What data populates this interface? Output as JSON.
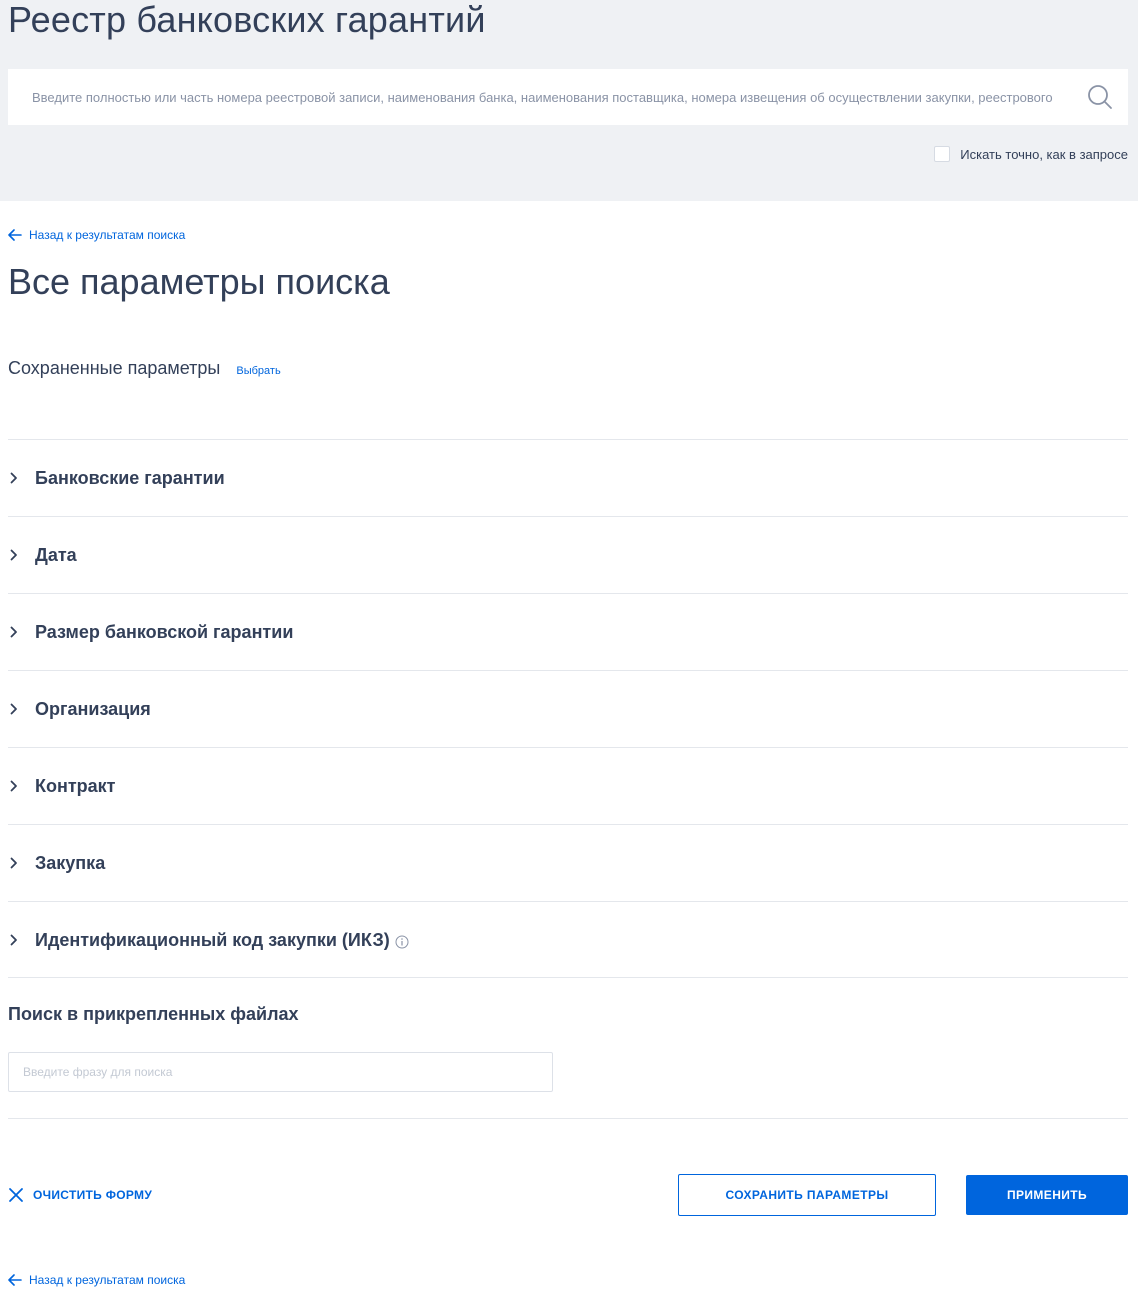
{
  "header": {
    "title": "Реестр банковских гарантий",
    "search_placeholder": "Введите полностью или часть номера реестровой записи, наименования банка, наименования поставщика, номера извещения об осуществлении закупки, реестрового",
    "search_icon": "search-icon",
    "exact_label": "Искать точно, как в запросе",
    "exact_checked": false
  },
  "nav": {
    "back_label": "Назад к результатам поиска",
    "back_icon": "arrow-left-icon"
  },
  "page": {
    "title": "Все параметры поиска",
    "saved_label": "Сохраненные параметры",
    "saved_choose": "Выбрать"
  },
  "accordion": [
    {
      "label": "Банковские гарантии"
    },
    {
      "label": "Дата"
    },
    {
      "label": "Размер банковской гарантии"
    },
    {
      "label": "Организация"
    },
    {
      "label": "Контракт"
    },
    {
      "label": "Закупка"
    },
    {
      "label": "Идентификационный код закупки (ИКЗ)",
      "icon": "info-icon"
    }
  ],
  "files": {
    "title": "Поиск в прикрепленных файлах",
    "placeholder": "Введите фразу для поиска"
  },
  "actions": {
    "clear_label": "ОЧИСТИТЬ ФОРМУ",
    "save_label": "СОХРАНИТЬ ПАРАМЕТРЫ",
    "apply_label": "ПРИМЕНИТЬ"
  },
  "colors": {
    "accent": "#0065dd",
    "text": "#334059",
    "header_bg": "#eff1f4"
  }
}
